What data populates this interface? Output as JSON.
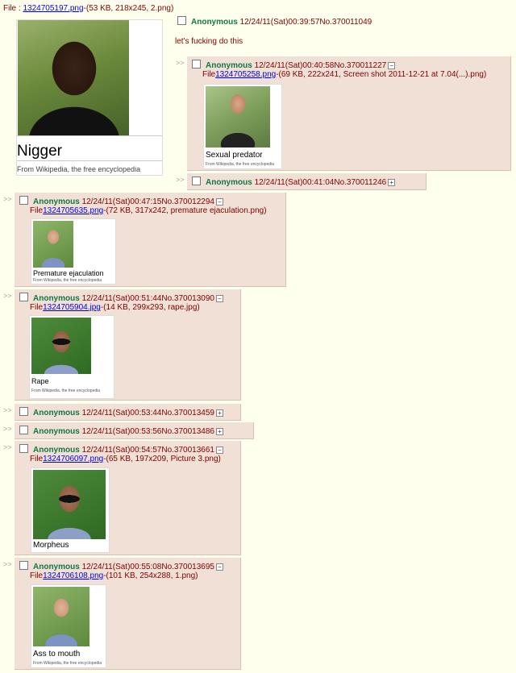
{
  "op": {
    "file_prefix": "File : ",
    "file_link": "1324705197.png",
    "file_meta": "-(53 KB, 218x245, 2.png)",
    "thumb_title": "Nigger",
    "thumb_subtitle": "From Wikipedia, the free encyclopedia",
    "name": "Anonymous",
    "datetime": "12/24/11(Sat)00:39:57",
    "post_no": "No.370011049",
    "message": "let's fucking do this"
  },
  "arrow": ">>",
  "file_word": "File",
  "replies": [
    {
      "name": "Anonymous",
      "datetime": "12/24/11(Sat)00:40:58",
      "post_no": "No.370011227",
      "toggle": "−",
      "file_link": "1324705258.png",
      "file_meta": "-(69 KB, 222x241, Screen shot 2011-12-21 at 7.04(...).png)",
      "thumb_title": "Sexual predator",
      "thumb_subtitle": "From Wikipedia, the free encyclopedia"
    },
    {
      "name": "Anonymous",
      "datetime": "12/24/11(Sat)00:41:04",
      "post_no": "No.370011246",
      "toggle": "+"
    },
    {
      "name": "Anonymous",
      "datetime": "12/24/11(Sat)00:47:15",
      "post_no": "No.370012294",
      "toggle": "−",
      "file_link": "1324705635.png",
      "file_meta": "-(72 KB, 317x242, premature ejaculation.png)",
      "thumb_title": "Premature ejaculation",
      "thumb_subtitle": "From Wikipedia, the free encyclopedia"
    },
    {
      "name": "Anonymous",
      "datetime": "12/24/11(Sat)00:51:44",
      "post_no": "No.370013090",
      "toggle": "−",
      "file_link": "1324705904.jpg",
      "file_meta": "-(14 KB, 299x293, rape.jpg)",
      "thumb_title": "Rape",
      "thumb_subtitle": "From Wikipedia, the free encyclopedia"
    },
    {
      "name": "Anonymous",
      "datetime": "12/24/11(Sat)00:53:44",
      "post_no": "No.370013459",
      "toggle": "+"
    },
    {
      "name": "Anonymous",
      "datetime": "12/24/11(Sat)00:53:56",
      "post_no": "No.370013486",
      "toggle": "+"
    },
    {
      "name": "Anonymous",
      "datetime": "12/24/11(Sat)00:54:57",
      "post_no": "No.370013661",
      "toggle": "−",
      "file_link": "1324706097.png",
      "file_meta": "-(65 KB, 197x209, Picture 3.png)",
      "thumb_title": "Morpheus"
    },
    {
      "name": "Anonymous",
      "datetime": "12/24/11(Sat)00:55:08",
      "post_no": "No.370013695",
      "toggle": "−",
      "file_link": "1324706108.png",
      "file_meta": "-(101 KB, 254x288, 1.png)",
      "thumb_title": "Ass to mouth",
      "thumb_subtitle": "From Wikipedia, the free encyclopedia"
    }
  ]
}
